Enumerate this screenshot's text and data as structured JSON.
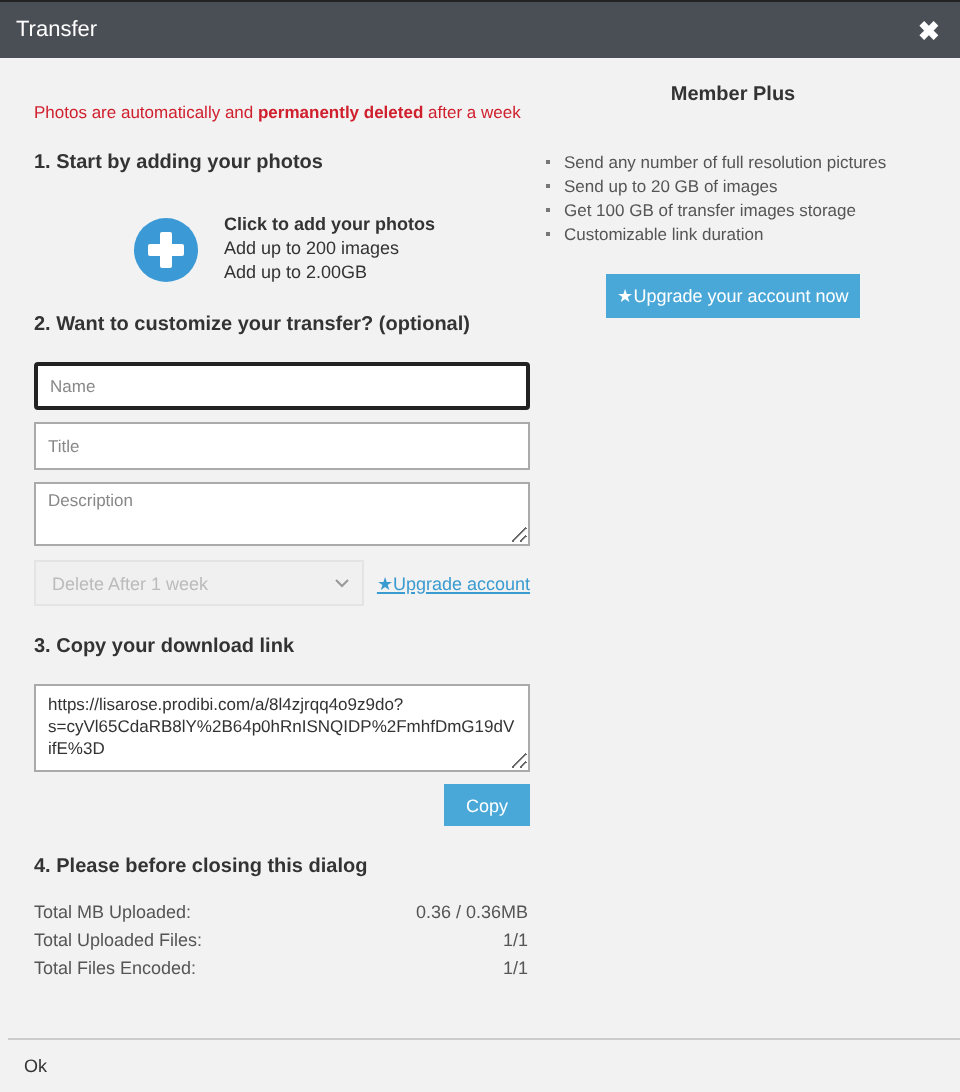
{
  "window": {
    "title": "Transfer",
    "close": "✖"
  },
  "notice": "Photos are automatically and **permanently deleted** after a week",
  "step1": {
    "heading": "1. Start by adding your photos",
    "add_title": "Click to add your photos",
    "add_lines": [
      "Add up to 200 images",
      "Add up to 2.00GB"
    ]
  },
  "step2": {
    "heading": "2. Want to customize your transfer? (optional)",
    "fields": [
      {
        "kind": "input",
        "placeholder": "Name",
        "focused": true
      },
      {
        "kind": "input",
        "placeholder": "Title",
        "focused": false
      },
      {
        "kind": "textarea",
        "placeholder": "Description",
        "focused": false
      }
    ],
    "duration": {
      "value": "Delete After 1 week",
      "disabled": true
    },
    "upgrade_link": "★Upgrade account"
  },
  "step3": {
    "heading": "3. Copy your download link",
    "link": "https://lisarose.prodibi.com/a/8l4zjrqq4o9z9do?s=cyVl65CdaRB8lY%2B64p0hRnISNQIDP%2FmhfDmG19dVifE%3D",
    "copy_button": "Copy"
  },
  "step4": {
    "heading": "4. Please before closing this dialog",
    "stats": [
      {
        "label": "Total MB Uploaded:",
        "value": "0.36 / 0.36MB"
      },
      {
        "label": "Total Uploaded Files:",
        "value": "1/1"
      },
      {
        "label": "Total Files Encoded:",
        "value": "1/1"
      }
    ]
  },
  "member": {
    "title": "Member Plus",
    "features": [
      "Send any number of full resolution pictures",
      "Send up to 20 GB of images",
      "Get 100 GB of transfer images storage",
      "Customizable link duration"
    ],
    "button": "★Upgrade your account now"
  },
  "footer": {
    "button": "Ok"
  }
}
